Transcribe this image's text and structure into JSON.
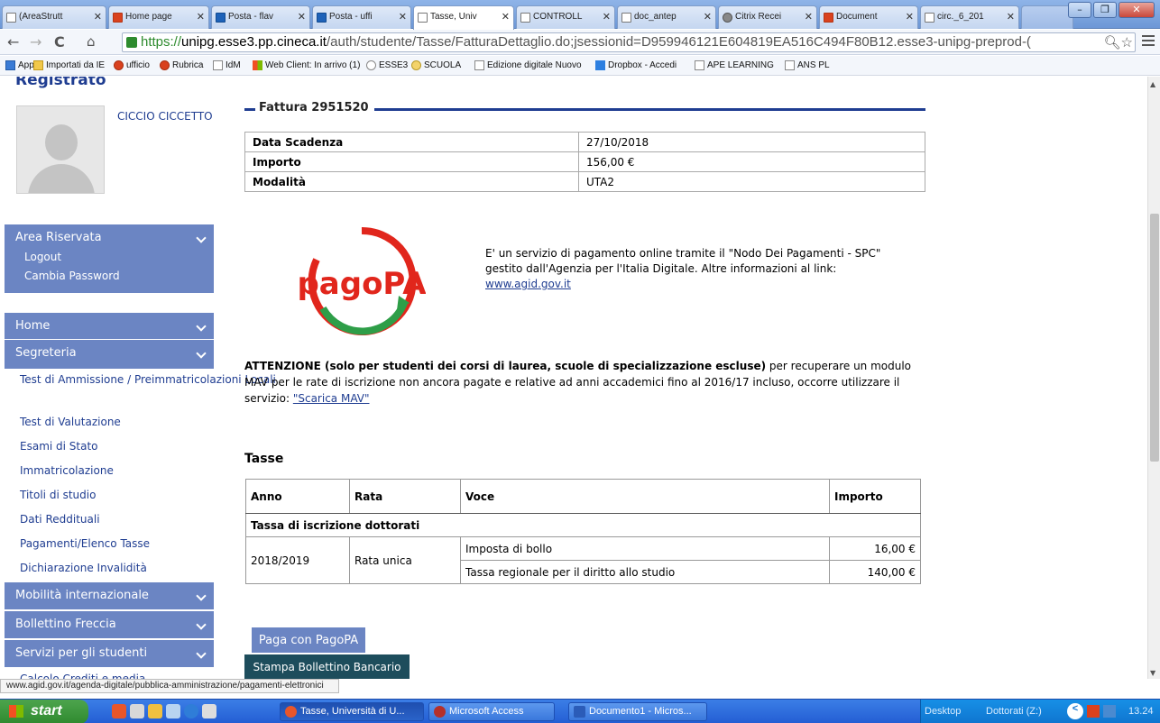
{
  "browser": {
    "tabs": [
      {
        "label": "(AreaStrutt",
        "icon": "page"
      },
      {
        "label": "Home page",
        "icon": "office"
      },
      {
        "label": "Posta - flav",
        "icon": "outlook"
      },
      {
        "label": "Posta - uffi",
        "icon": "outlook"
      },
      {
        "label": "Tasse, Univ",
        "icon": "page"
      },
      {
        "label": "CONTROLL",
        "icon": "page"
      },
      {
        "label": "doc_antep",
        "icon": "page"
      },
      {
        "label": "Citrix Recei",
        "icon": "citrix"
      },
      {
        "label": "Document",
        "icon": "office"
      },
      {
        "label": "circ._6_201",
        "icon": "page"
      }
    ],
    "url_scheme": "https://",
    "url_host": "unipg.esse3.pp.cineca.it",
    "url_path": "/auth/studente/Tasse/FatturaDettaglio.do;jsessionid=D959946121E604819EA516C494F80B12.esse3-unipg-preprod-(",
    "bookmarks": [
      "App",
      "Importati da IE",
      "ufficio",
      "Rubrica",
      "IdM",
      "Web Client: In arrivo (1)",
      "ESSE3",
      "SCUOLA",
      "Edizione digitale Nuovo",
      "Dropbox - Accedi",
      "APE LEARNING",
      "ANS PL"
    ]
  },
  "sidebar": {
    "cut_title": "Registrato",
    "user_name": "CICCIO CICCETTO",
    "area": {
      "title": "Area Riservata",
      "items": [
        "Logout",
        "Cambia Password"
      ]
    },
    "home": "Home",
    "segreteria": "Segreteria",
    "segreteria_items": [
      "Test di Ammissione / Preimmatricolazioni Locali",
      "Test di Valutazione",
      "Esami di Stato",
      "Immatricolazione",
      "Titoli di studio",
      "Dati Reddituali",
      "Pagamenti/Elenco Tasse",
      "Dichiarazione Invalidità"
    ],
    "mobilita": "Mobilità internazionale",
    "bollettino": "Bollettino Freccia",
    "servizi": "Servizi per gli studenti",
    "cut_item": "Calcolo Crediti e media"
  },
  "invoice": {
    "title": "Fattura 2951520",
    "rows": [
      {
        "k": "Data Scadenza",
        "v": "27/10/2018"
      },
      {
        "k": "Importo",
        "v": "156,00 €"
      },
      {
        "k": "Modalità",
        "v": "UTA2"
      }
    ]
  },
  "pagopa": {
    "logo_text": "pagoPA",
    "text": "E' un servizio di pagamento online tramite il \"Nodo Dei Pagamenti - SPC\" gestito dall'Agenzia per l'Italia Digitale. Altre informazioni al link:",
    "link": "www.agid.gov.it"
  },
  "attention": {
    "bold": "ATTENZIONE (solo per studenti dei corsi di laurea, scuole di specializzazione escluse)",
    "text": " per recuperare un modulo MAV per le rate di iscrizione non ancora pagate e relative ad anni accademici fino al 2016/17 incluso, occorre utilizzare il servizio: ",
    "link": "\"Scarica MAV\""
  },
  "tasse": {
    "title": "Tasse",
    "headers": [
      "Anno",
      "Rata",
      "Voce",
      "Importo"
    ],
    "section": "Tassa di iscrizione dottorati",
    "anno": "2018/2019",
    "rata": "Rata unica",
    "items": [
      {
        "voce": "Imposta di bollo",
        "importo": "16,00 €"
      },
      {
        "voce": "Tassa regionale per il diritto allo studio",
        "importo": "140,00 €"
      }
    ]
  },
  "buttons": {
    "pagopa": "Paga con PagoPA",
    "stampa": "Stampa Bollettino Bancario"
  },
  "statusbar": "www.agid.gov.it/agenda-digitale/pubblica-amministrazione/pagamenti-elettronici",
  "taskbar": {
    "start": "start",
    "items": [
      "Tasse, Università di U...",
      "Microsoft Access",
      "Documento1 - Micros..."
    ],
    "desktop": "Desktop",
    "drive": "Dottorati (Z:)",
    "clock": "13.24"
  }
}
